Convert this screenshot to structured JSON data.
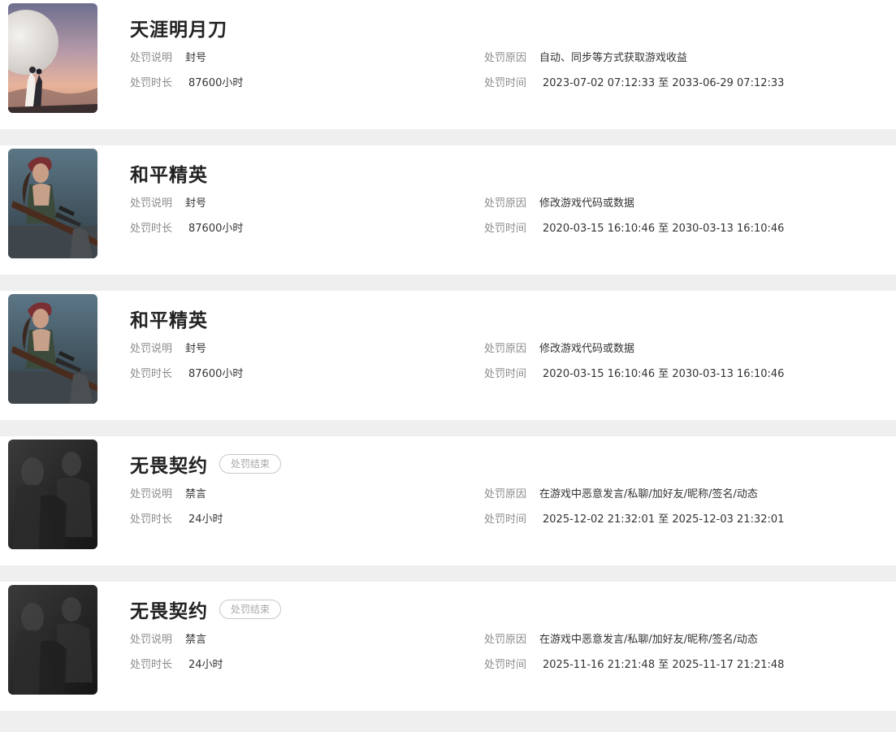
{
  "labels": {
    "desc": "处罚说明",
    "duration": "处罚时长",
    "reason": "处罚原因",
    "time": "处罚时间"
  },
  "records": [
    {
      "game": "天涯明月刀",
      "cover": "moon-cover",
      "badge": "",
      "desc": "封号",
      "duration": "87600小时",
      "reason": "自动、同步等方式获取游戏收益",
      "time": "2023-07-02 07:12:33 至 2033-06-29 07:12:33"
    },
    {
      "game": "和平精英",
      "cover": "soldier-cover",
      "badge": "",
      "desc": "封号",
      "duration": "87600小时",
      "reason": "修改游戏代码或数据",
      "time": "2020-03-15 16:10:46 至 2030-03-13 16:10:46"
    },
    {
      "game": "和平精英",
      "cover": "soldier-cover",
      "badge": "",
      "desc": "封号",
      "duration": "87600小时",
      "reason": "修改游戏代码或数据",
      "time": "2020-03-15 16:10:46 至 2030-03-13 16:10:46"
    },
    {
      "game": "无畏契约",
      "cover": "dark-cover",
      "badge": "处罚结束",
      "desc": "禁言",
      "duration": "24小时",
      "reason": "在游戏中恶意发言/私聊/加好友/昵称/签名/动态",
      "time": "2025-12-02 21:32:01 至 2025-12-03 21:32:01"
    },
    {
      "game": "无畏契约",
      "cover": "dark-cover",
      "badge": "处罚结束",
      "desc": "禁言",
      "duration": "24小时",
      "reason": "在游戏中恶意发言/私聊/加好友/昵称/签名/动态",
      "time": "2025-11-16 21:21:48 至 2025-11-17 21:21:48"
    }
  ]
}
